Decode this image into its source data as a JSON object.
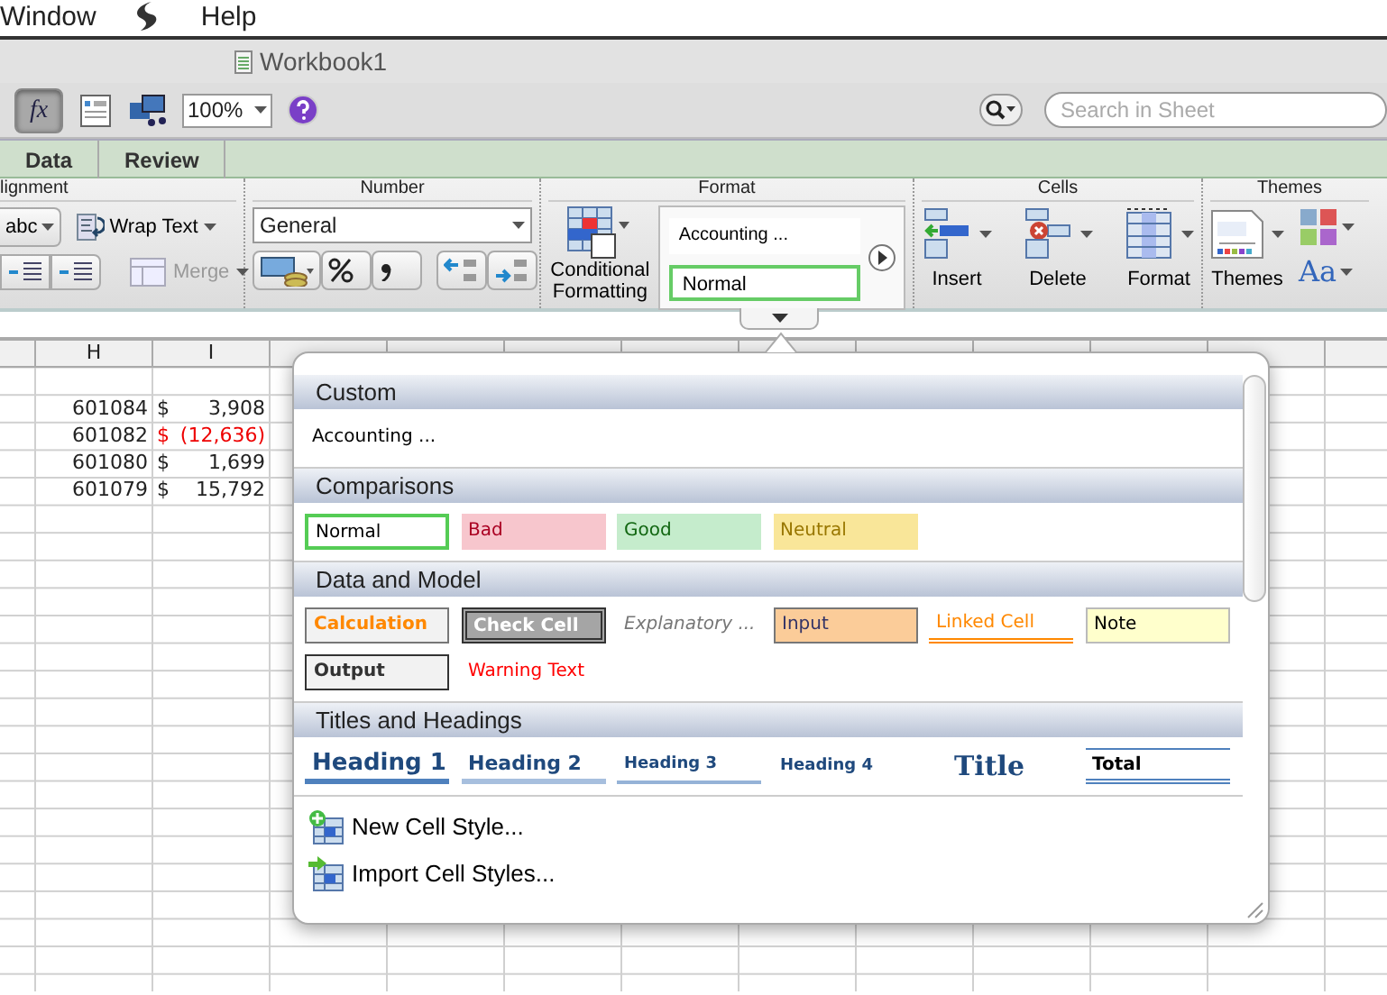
{
  "menu_bar": {
    "items": [
      "Window",
      "Help"
    ]
  },
  "window": {
    "title": "Workbook1"
  },
  "toolbar": {
    "formula_button": {
      "label": "fx",
      "selected": true
    },
    "zoom": "100%",
    "search": {
      "placeholder": "Search in Sheet"
    }
  },
  "ribbon": {
    "tabs": [
      {
        "label": "Data",
        "selected": false
      },
      {
        "label": "Review",
        "selected": false
      }
    ],
    "alignment": {
      "title": "lignment",
      "orientation": "abc",
      "wrap_text": "Wrap Text",
      "merge": {
        "label": "Merge",
        "disabled": true
      }
    },
    "number": {
      "title": "Number",
      "format": "General"
    },
    "format": {
      "title": "Format",
      "conditional_formatting": "Conditional Formatting",
      "styles": [
        {
          "label": "Accounting ...",
          "kind": "plain"
        },
        {
          "label": "Normal",
          "kind": "normal"
        }
      ]
    },
    "cells": {
      "title": "Cells",
      "buttons": [
        "Insert",
        "Delete",
        "Format"
      ]
    },
    "themes": {
      "title": "Themes",
      "button": "Themes",
      "fonts": "Aa"
    }
  },
  "sheet": {
    "columns": [
      "H",
      "I"
    ],
    "rows": [
      {
        "number": "601084",
        "currency": "$",
        "amount": "3,908",
        "negative": false
      },
      {
        "number": "601082",
        "currency": "$",
        "amount": "(12,636)",
        "negative": true
      },
      {
        "number": "601080",
        "currency": "$",
        "amount": "1,699",
        "negative": false
      },
      {
        "number": "601079",
        "currency": "$",
        "amount": "15,792",
        "negative": false
      }
    ]
  },
  "style_gallery": {
    "sections": [
      {
        "title": "Custom",
        "styles": [
          {
            "label": "Accounting ...",
            "kind": "plain"
          }
        ]
      },
      {
        "title": "Comparisons",
        "styles": [
          {
            "label": "Normal",
            "kind": "normal"
          },
          {
            "label": "Bad",
            "kind": "bad"
          },
          {
            "label": "Good",
            "kind": "good"
          },
          {
            "label": "Neutral",
            "kind": "neutral"
          }
        ]
      },
      {
        "title": "Data and Model",
        "styles": [
          {
            "label": "Calculation",
            "kind": "calculation"
          },
          {
            "label": "Check Cell",
            "kind": "check"
          },
          {
            "label": "Explanatory ...",
            "kind": "explanatory"
          },
          {
            "label": "Input",
            "kind": "input"
          },
          {
            "label": "Linked Cell",
            "kind": "linked"
          },
          {
            "label": "Note",
            "kind": "note"
          },
          {
            "label": "Output",
            "kind": "output"
          },
          {
            "label": "Warning Text",
            "kind": "warning"
          }
        ]
      },
      {
        "title": "Titles and Headings",
        "styles": [
          {
            "label": "Heading 1",
            "kind": "heading1"
          },
          {
            "label": "Heading 2",
            "kind": "heading2"
          },
          {
            "label": "Heading 3",
            "kind": "heading3"
          },
          {
            "label": "Heading 4",
            "kind": "heading4"
          },
          {
            "label": "Title",
            "kind": "title"
          },
          {
            "label": "Total",
            "kind": "total"
          }
        ]
      }
    ],
    "actions": [
      {
        "label": "New Cell Style...",
        "kind": "new"
      },
      {
        "label": "Import Cell Styles...",
        "kind": "import"
      }
    ]
  }
}
